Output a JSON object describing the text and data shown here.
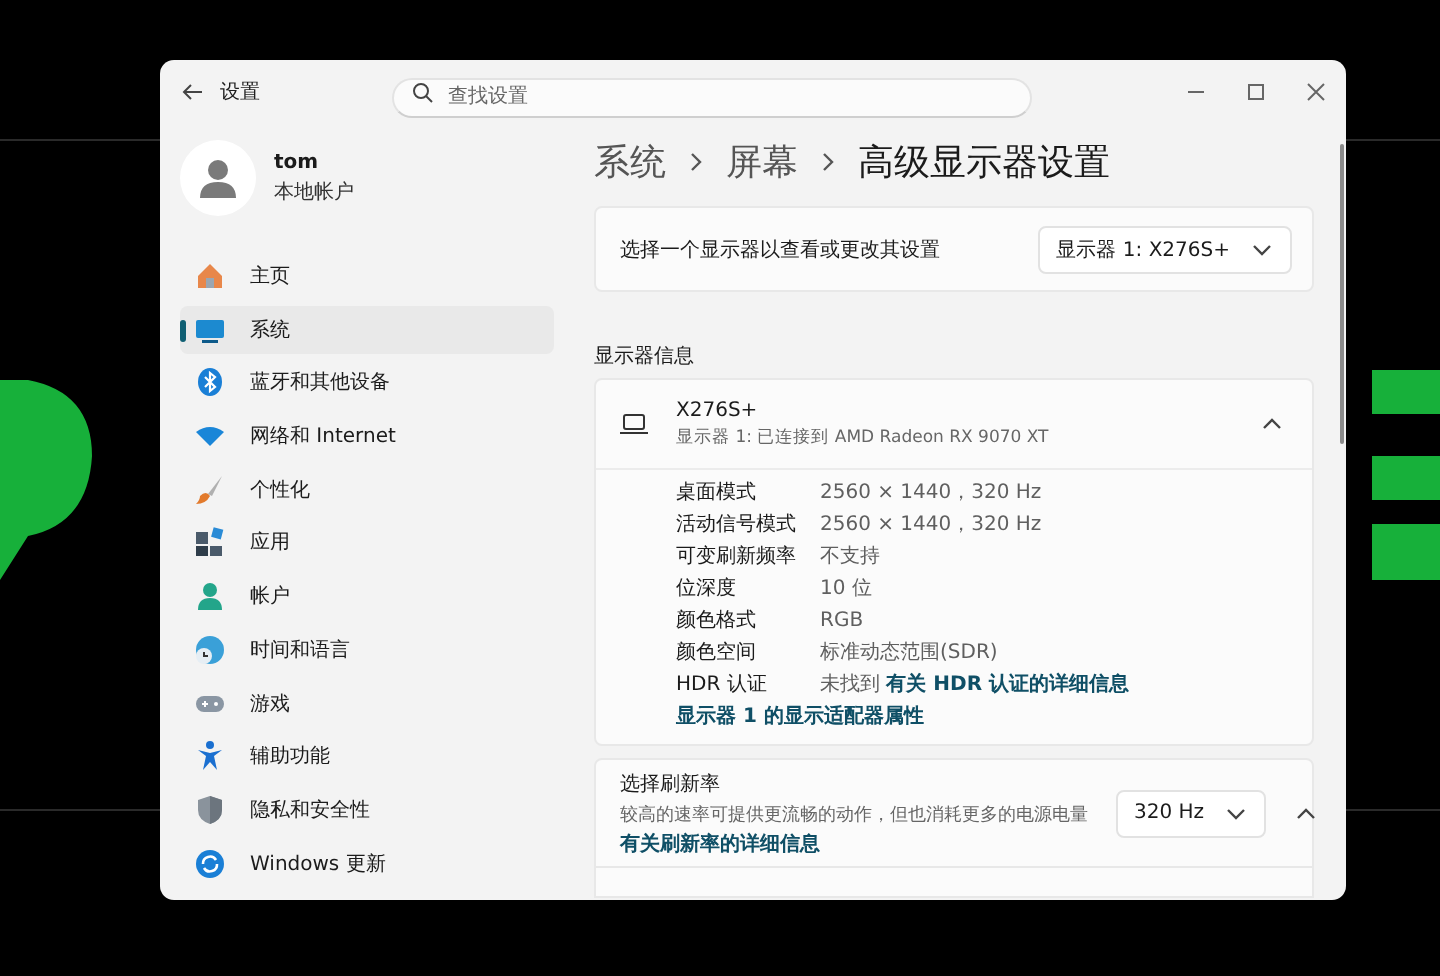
{
  "window": {
    "title": "设置",
    "search": {
      "placeholder": "查找设置"
    }
  },
  "user": {
    "name": "tom",
    "account_type": "本地帐户"
  },
  "sidebar": {
    "items": [
      {
        "label": "主页",
        "kind": "home",
        "selected": false
      },
      {
        "label": "系统",
        "kind": "system",
        "selected": true
      },
      {
        "label": "蓝牙和其他设备",
        "kind": "bluetooth",
        "selected": false
      },
      {
        "label": "网络和 Internet",
        "kind": "network",
        "selected": false
      },
      {
        "label": "个性化",
        "kind": "brush",
        "selected": false
      },
      {
        "label": "应用",
        "kind": "apps",
        "selected": false
      },
      {
        "label": "帐户",
        "kind": "account",
        "selected": false
      },
      {
        "label": "时间和语言",
        "kind": "time",
        "selected": false
      },
      {
        "label": "游戏",
        "kind": "gaming",
        "selected": false
      },
      {
        "label": "辅助功能",
        "kind": "accessibility",
        "selected": false
      },
      {
        "label": "隐私和安全性",
        "kind": "privacy",
        "selected": false
      },
      {
        "label": "Windows 更新",
        "kind": "update",
        "selected": false
      }
    ]
  },
  "breadcrumb": [
    "系统",
    "屏幕",
    "高级显示器设置"
  ],
  "display_select": {
    "label": "选择一个显示器以查看或更改其设置",
    "value": "显示器 1: X276S+"
  },
  "display_info": {
    "heading": "显示器信息",
    "monitor": "X276S+",
    "connection": "显示器 1: 已连接到 AMD Radeon RX 9070 XT",
    "expanded": true,
    "rows": [
      {
        "label": "桌面模式",
        "value": "2560 × 1440，320 Hz"
      },
      {
        "label": "活动信号模式",
        "value": "2560 × 1440，320 Hz"
      },
      {
        "label": "可变刷新频率",
        "value": "不支持"
      },
      {
        "label": "位深度",
        "value": "10 位"
      },
      {
        "label": "颜色格式",
        "value": "RGB"
      },
      {
        "label": "颜色空间",
        "value": "标准动态范围(SDR)"
      },
      {
        "label": "HDR 认证",
        "value": "未找到",
        "link": "有关 HDR 认证的详细信息"
      }
    ],
    "adapter_link": "显示器 1 的显示适配器属性"
  },
  "refresh_rate": {
    "title": "选择刷新率",
    "description": "较高的速率可提供更流畅的动作，但也消耗更多的电源电量",
    "link": "有关刷新率的详细信息",
    "value": "320 Hz",
    "expanded": true
  }
}
